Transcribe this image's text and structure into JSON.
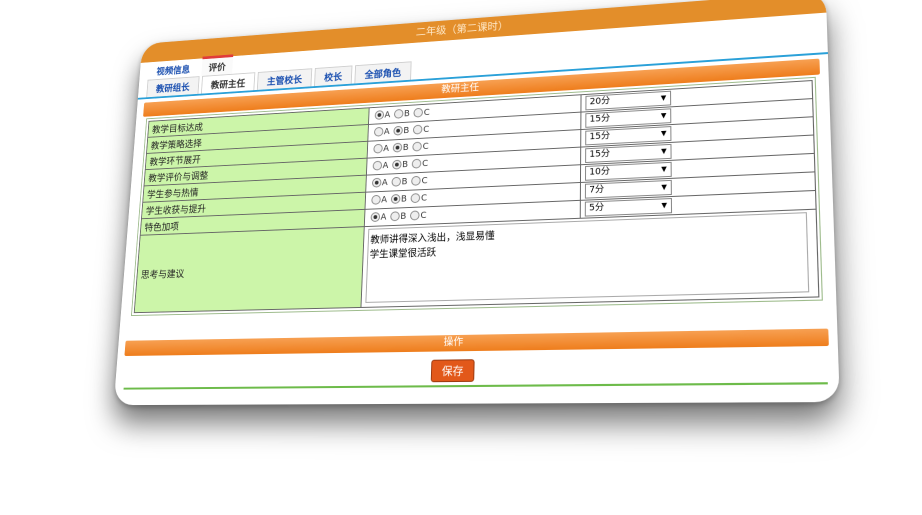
{
  "window": {
    "title": "二年级（第二课时）"
  },
  "top_tabs": [
    {
      "label": "视频信息",
      "active": false
    },
    {
      "label": "评价",
      "active": true
    }
  ],
  "sub_tabs": [
    {
      "label": "教研组长",
      "active": false
    },
    {
      "label": "教研主任",
      "active": true
    },
    {
      "label": "主管校长",
      "active": false
    },
    {
      "label": "校长",
      "active": false
    },
    {
      "label": "全部角色",
      "active": false
    }
  ],
  "section": {
    "title": "教研主任"
  },
  "radio_labels": [
    "A",
    "B",
    "C"
  ],
  "rows": [
    {
      "label": "教学目标达成",
      "selected": "A",
      "score": "20分"
    },
    {
      "label": "教学策略选择",
      "selected": "B",
      "score": "15分"
    },
    {
      "label": "教学环节展开",
      "selected": "B",
      "score": "15分"
    },
    {
      "label": "教学评价与调整",
      "selected": "B",
      "score": "15分"
    },
    {
      "label": "学生参与热情",
      "selected": "A",
      "score": "10分"
    },
    {
      "label": "学生收获与提升",
      "selected": "B",
      "score": "7分"
    },
    {
      "label": "特色加项",
      "selected": "A",
      "score": "5分"
    }
  ],
  "suggestion": {
    "label": "思考与建议",
    "value": "教师讲得深入浅出，浅显易懂\n学生课堂很活跃"
  },
  "operation": {
    "title": "操作",
    "save_label": "保存"
  },
  "colors": {
    "accent": "#ee7d1c",
    "label_bg": "#ccf5a9",
    "tab_link": "#1a4fb0"
  }
}
